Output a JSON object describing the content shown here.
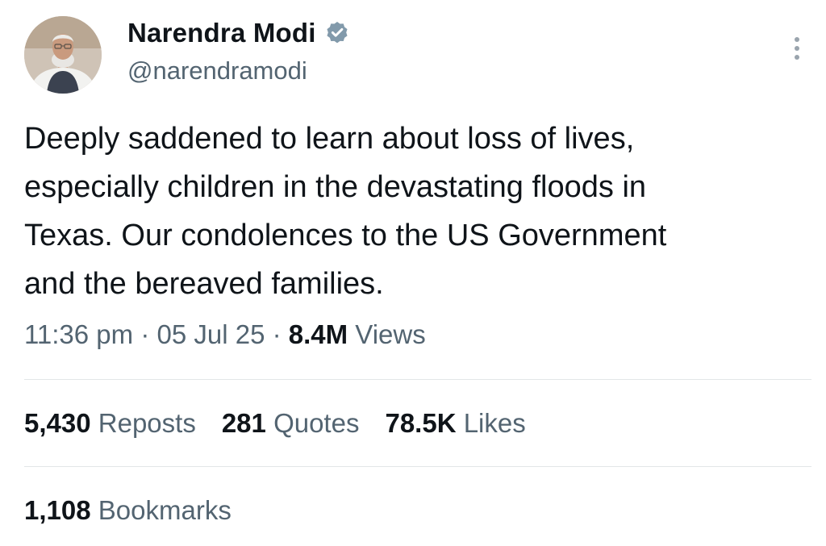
{
  "author": {
    "display_name": "Narendra Modi",
    "handle": "@narendramodi",
    "avatar_icon": "profile-photo",
    "verified_icon": "verified-badge-icon",
    "verified_color": "#829aab"
  },
  "tweet": {
    "text": "Deeply saddened to learn about loss of lives,\nespecially children in the devastating floods in\nTexas. Our condolences to the US Government\nand the bereaved families."
  },
  "meta": {
    "time": "11:36 pm",
    "separator": " · ",
    "date": "05 Jul 25",
    "views_count": "8.4M",
    "views_label": "Views"
  },
  "stats": {
    "reposts_count": "5,430",
    "reposts_label": "Reposts",
    "quotes_count": "281",
    "quotes_label": "Quotes",
    "likes_count": "78.5K",
    "likes_label": "Likes",
    "bookmarks_count": "1,108",
    "bookmarks_label": "Bookmarks"
  },
  "more_icon": "more-options-icon",
  "colors": {
    "text_primary": "#0f1419",
    "text_secondary": "#536471",
    "divider": "#e3e6e8"
  }
}
